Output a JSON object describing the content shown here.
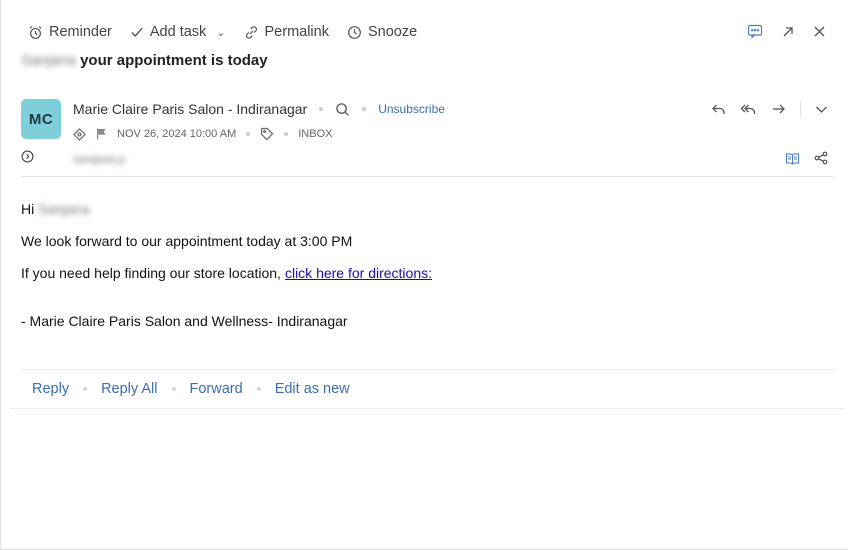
{
  "toolbar": {
    "reminder": "Reminder",
    "add_task": "Add task",
    "permalink": "Permalink",
    "snooze": "Snooze"
  },
  "subject": {
    "recipient_name": "Sanjana",
    "text": "your appointment is today"
  },
  "sender": {
    "initials": "MC",
    "name": "Marie Claire Paris Salon - Indiranagar",
    "unsubscribe": "Unsubscribe",
    "date": "NOV 26, 2024 10:00 AM",
    "folder": "INBOX",
    "recipient": "sanjana.p",
    "avatar_color": "#7ecfd9"
  },
  "body": {
    "greeting": "Hi",
    "greeting_name": "Sanjana",
    "line1": "We look forward to our appointment today at 3:00 PM",
    "line2": "If you need help finding our store location,",
    "link": "click here for directions:",
    "signature": "- Marie Claire Paris Salon and Wellness- Indiranagar"
  },
  "actions": {
    "reply": "Reply",
    "reply_all": "Reply All",
    "forward": "Forward",
    "edit_as_new": "Edit as new"
  },
  "colors": {
    "link": "#3a6fb0",
    "body_link": "#1a0dab"
  }
}
